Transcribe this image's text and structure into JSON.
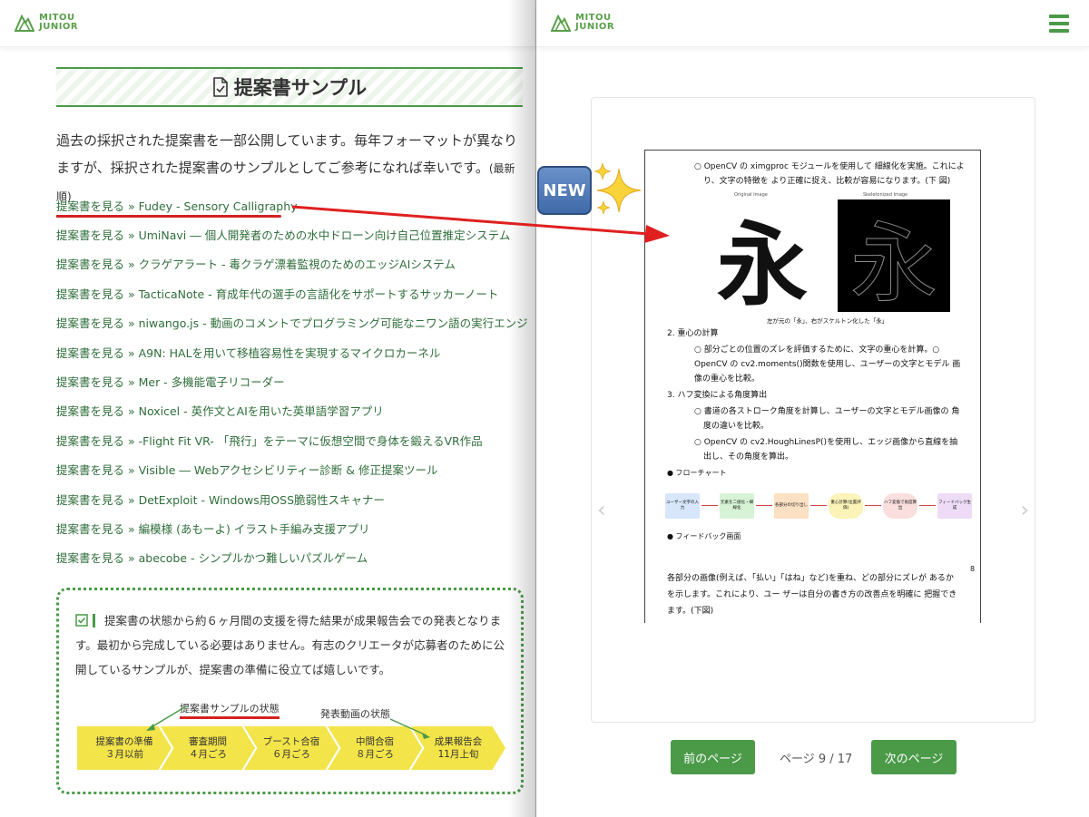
{
  "brand": {
    "line1": "MITOU",
    "line2": "JUNIOR",
    "color": "#5a9f4a"
  },
  "left": {
    "title": "提案書サンプル",
    "intro": "過去の採択された提案書を一部公開しています。毎年フォーマットが異なりますが、採択された提案書のサンプルとしてご参考になれば幸いです。",
    "intro_note": "(最新順)",
    "links": [
      "提案書を見る » Fudey - Sensory Calligraphy",
      "提案書を見る » UmiNavi ― 個人開発者のための水中ドローン向け自己位置推定システム",
      "提案書を見る » クラゲアラート - 毒クラゲ漂着監視のためのエッジAIシステム",
      "提案書を見る » TacticaNote - 育成年代の選手の言語化をサポートするサッカーノート",
      "提案書を見る » niwango.js - 動画のコメントでプログラミング可能なニワン語の実行エンジン",
      "提案書を見る » A9N: HALを用いて移植容易性を実現するマイクロカーネル",
      "提案書を見る » Mer - 多機能電子リコーダー",
      "提案書を見る » Noxicel - 英作文とAIを用いた英単語学習アプリ",
      "提案書を見る » -Flight Fit VR- 「飛行」をテーマに仮想空間で身体を鍛えるVR作品",
      "提案書を見る » Visible ― Webアクセシビリティー診断 & 修正提案ツール",
      "提案書を見る » DetExploit - Windows用OSS脆弱性スキャナー",
      "提案書を見る » 編模様 (あもーよ) イラスト手編み支援アプリ",
      "提案書を見る » abecobe - シンプルかつ難しいパズルゲーム"
    ],
    "info_text": "提案書の状態から約６ヶ月間の支援を得た結果が成果報告会での発表となります。最初から完成している必要はありません。有志のクリエータが応募者のために公開しているサンプルが、提案書の準備に役立てば嬉しいです。",
    "timeline_labels": {
      "sample_state": "提案書サンプルの状態",
      "video_state": "発表動画の状態"
    },
    "timeline": [
      {
        "title": "提案書の準備",
        "date": "３月以前"
      },
      {
        "title": "審査期間",
        "date": "４月ごろ"
      },
      {
        "title": "ブースト合宿",
        "date": "６月ごろ"
      },
      {
        "title": "中間合宿",
        "date": "８月ごろ"
      },
      {
        "title": "成果報告会",
        "date": "11月上旬"
      }
    ]
  },
  "viewer": {
    "prev_label": "前のページ",
    "next_label": "次のページ",
    "page_indicator": "ページ 9 / 17",
    "pdf": {
      "bullet1": "○ OpenCV の ximgproc モジュールを使用して 細線化を実施。これにより、文字の特徴を より正確に捉え、比較が容易になります。(下 図)",
      "bullet1_line1": "○ OpenCV の ximgproc モジュールを使用して 細線化を実施。これによ",
      "bullet1_line2": "り、文字の特徴を より正確に捉え、比較が容易になります。(下 図)",
      "original_caption": "Original Image",
      "skeleton_caption": "Skeletonized Image",
      "kanji": "永",
      "figure_caption": "左が元の「永」、右がスケルトン化した「永」",
      "h2": "2. 重心の計算",
      "h2_b1": "○ 部分ごとの位置のズレを評価するために、文字の重心を計算。○",
      "h2_b2": "OpenCV の cv2.moments()関数を使用し、ユーザーの文字とモデル 画",
      "h2_b3": "像の重心を比較。",
      "h3": "3. ハフ変換による角度算出",
      "h3_b1": "○ 書道の各ストローク角度を計算し、ユーザーの文字とモデル画像の 角",
      "h3_b2": "度の違いを比較。",
      "h3_b3": "○ OpenCV の cv2.HoughLinesP()を使用し、エッジ画像から直線を抽",
      "h3_b4": "出し、その角度を算出。",
      "flowchart_title": "● フローチャート",
      "flow_nodes": [
        "ユーザー文字の入力",
        "元素を二値化・細線化",
        "各部分の切り出し",
        "重心計算(位置評価)",
        "ハフ変換で角度算出",
        "フィードバック生成"
      ],
      "feedback_title": "● フィードバック画面",
      "page_num": "8",
      "para1": "各部分の画像(例えば、「払い」「はね」など)を重ね、どの部分にズレが あるか",
      "para2": "を示します。これにより、ユー ザーは自分の書き方の改善点を明確に 把握でき",
      "para3": "ます。(下図)"
    }
  },
  "overlay": {
    "new_badge": "NEW"
  },
  "colors": {
    "green": "#4a9a48",
    "link": "#2f6e3b",
    "red": "#d42222",
    "timeline_yellow": "#f3e44a",
    "new_blue": "#4f78b8"
  }
}
